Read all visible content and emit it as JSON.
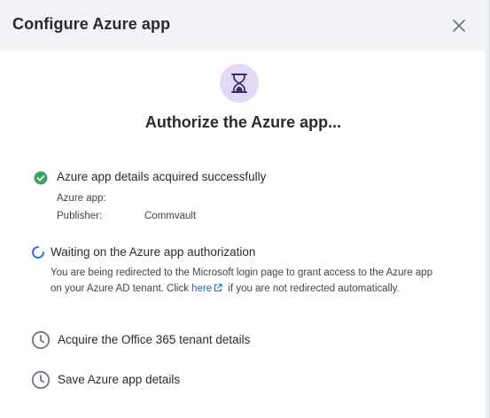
{
  "dialog": {
    "title": "Configure Azure app",
    "close_icon": "close-icon",
    "hero_icon": "hourglass-icon",
    "heading": "Authorize the Azure app..."
  },
  "steps": [
    {
      "status": "done",
      "icon": "check-circle-icon",
      "title": "Azure app details acquired successfully",
      "details": {
        "app_label": "Azure app:",
        "app_value": "",
        "publisher_label": "Publisher:",
        "publisher_value": "Commvault"
      }
    },
    {
      "status": "in-progress",
      "icon": "spinner-icon",
      "title": "Waiting on the Azure app authorization",
      "description_before": "You are being redirected to the Microsoft login page to grant access to the Azure app on your Azure AD tenant. Click ",
      "link_text": "here",
      "link_icon": "external-link-icon",
      "description_after": " if you are not redirected automatically."
    },
    {
      "status": "pending",
      "icon": "clock-icon",
      "title": "Acquire the Office 365 tenant details"
    },
    {
      "status": "pending",
      "icon": "clock-icon",
      "title": "Save Azure app details"
    }
  ],
  "colors": {
    "header_bg": "#f1f3f6",
    "success": "#3aa564",
    "spinner": "#2a7bd4",
    "pending": "#6b7686",
    "hero_bg": "#e4d8f7",
    "hero_fg": "#3b2c6e",
    "link": "#1f66c9"
  }
}
